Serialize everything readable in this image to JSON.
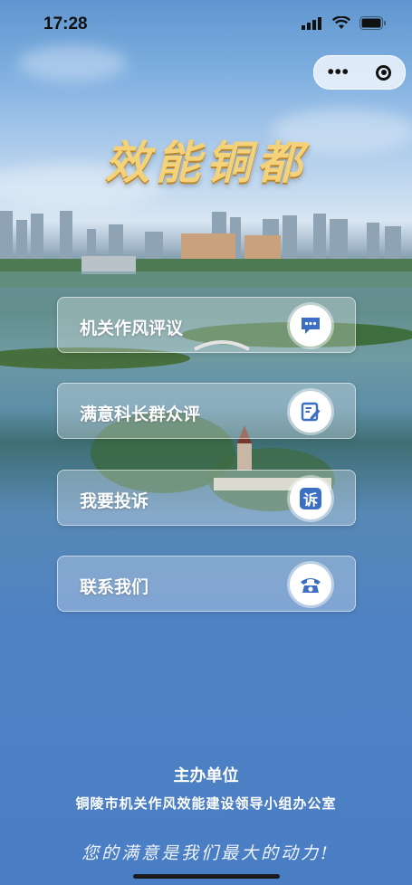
{
  "status_bar": {
    "time": "17:28"
  },
  "capsule": {
    "more_icon": "more-dots-icon",
    "close_icon": "target-icon"
  },
  "logo": {
    "text": "效能铜都"
  },
  "menu": [
    {
      "label": "机关作风评议",
      "icon": "chat-bubble-icon"
    },
    {
      "label": "满意科长群众评",
      "icon": "edit-note-icon"
    },
    {
      "label": "我要投诉",
      "icon": "complaint-icon",
      "icon_text": "诉"
    },
    {
      "label": "联系我们",
      "icon": "telephone-icon"
    }
  ],
  "footer": {
    "title": "主办单位",
    "organizer": "铜陵市机关作风效能建设领导小组办公室",
    "slogan": "您的满意是我们最大的动力!"
  },
  "colors": {
    "accent_blue": "#3a6fc4",
    "logo_gold": "#f3d27a"
  }
}
